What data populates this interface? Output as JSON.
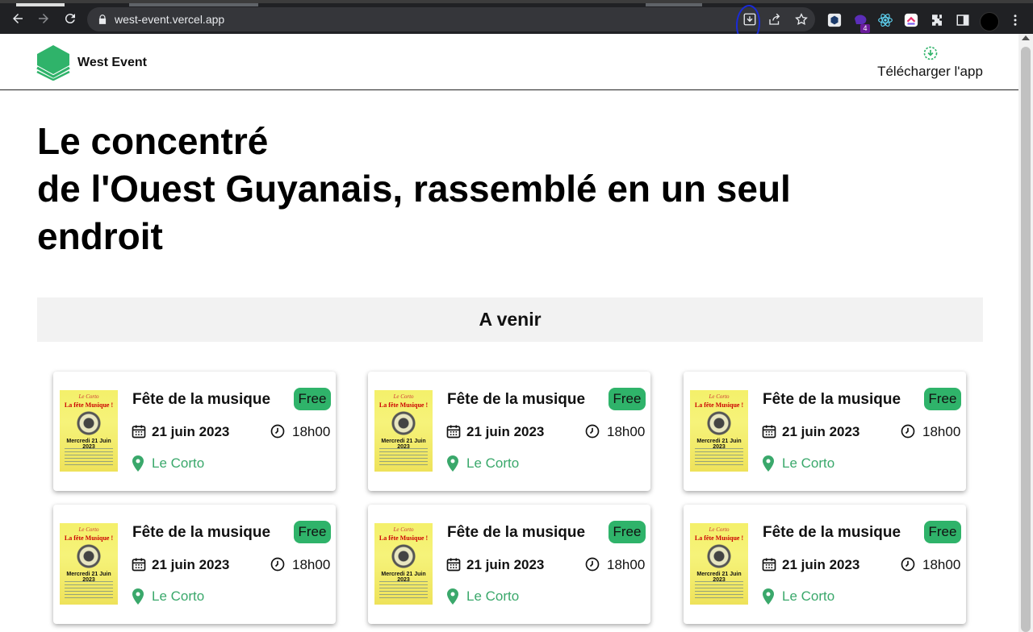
{
  "browser": {
    "url": "west-event.vercel.app",
    "extension_badge": "4",
    "icons": [
      "back-arrow-icon",
      "forward-arrow-icon",
      "reload-icon",
      "lock-icon",
      "install-app-icon",
      "share-icon",
      "star-icon",
      "extension-icon",
      "extension-icon",
      "react-icon",
      "extension-icon",
      "puzzle-icon",
      "side-panel-icon",
      "kebab-menu-icon"
    ]
  },
  "header": {
    "brand": "West Event",
    "download_label": "Télécharger l'app",
    "accent": "#2fb36a"
  },
  "hero": {
    "line1": "Le concentré",
    "line2": "de l'Ouest Guyanais, rassemblé en un seul endroit"
  },
  "section": {
    "title": "A venir"
  },
  "events": [
    {
      "title": "Fête de la musique",
      "badge": "Free",
      "date": "21 juin 2023",
      "time": "18h00",
      "location": "Le Corto"
    },
    {
      "title": "Fête de la musique",
      "badge": "Free",
      "date": "21 juin 2023",
      "time": "18h00",
      "location": "Le Corto"
    },
    {
      "title": "Fête de la musique",
      "badge": "Free",
      "date": "21 juin 2023",
      "time": "18h00",
      "location": "Le Corto"
    },
    {
      "title": "Fête de la musique",
      "badge": "Free",
      "date": "21 juin 2023",
      "time": "18h00",
      "location": "Le Corto"
    },
    {
      "title": "Fête de la musique",
      "badge": "Free",
      "date": "21 juin 2023",
      "time": "18h00",
      "location": "Le Corto"
    },
    {
      "title": "Fête de la musique",
      "badge": "Free",
      "date": "21 juin 2023",
      "time": "18h00",
      "location": "Le Corto"
    }
  ],
  "poster": {
    "venue": "Le Corto",
    "headline": "La fête Musique !",
    "date": "Mercredi 21 Juin 2023"
  }
}
